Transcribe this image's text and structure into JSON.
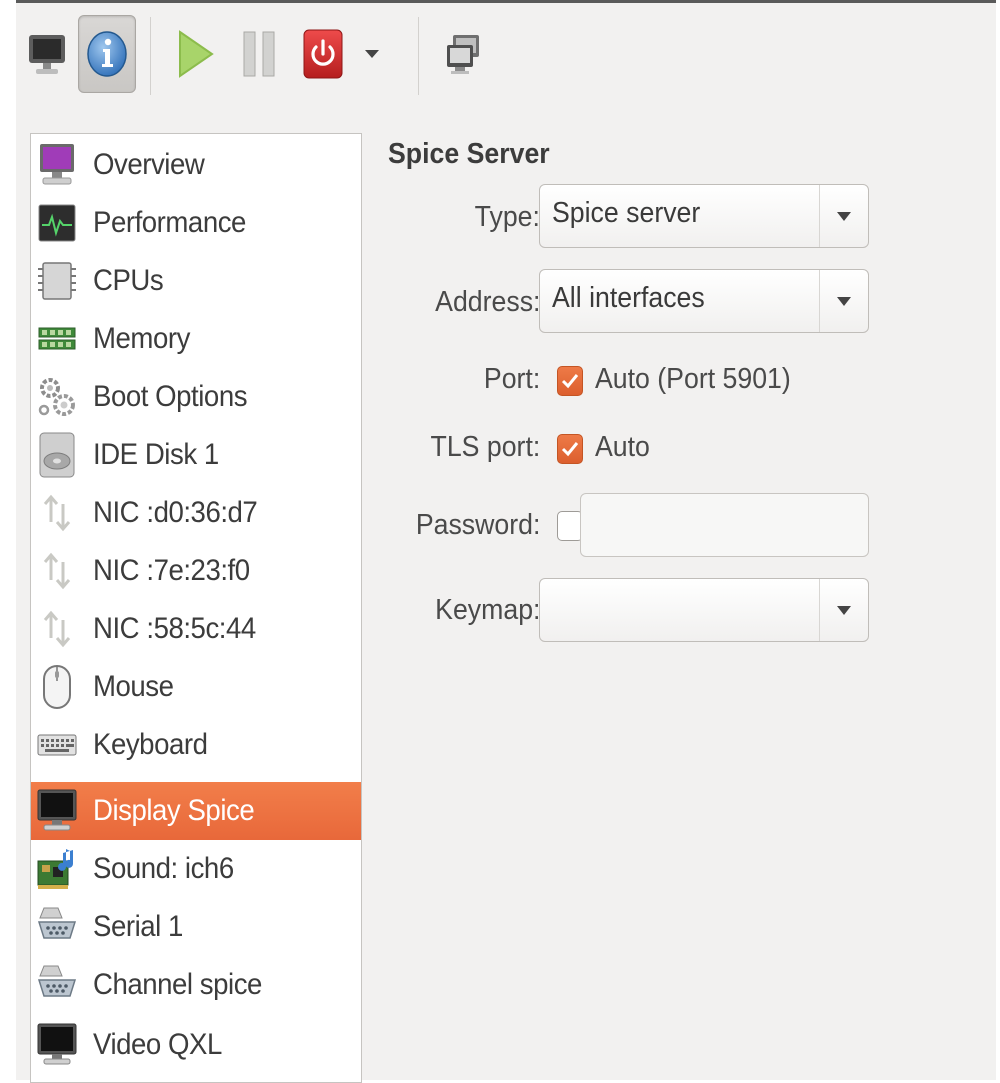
{
  "toolbar": {
    "buttons": [
      {
        "name": "console",
        "icon": "monitor-icon"
      },
      {
        "name": "details",
        "icon": "info-icon",
        "active": true
      },
      {
        "name": "run",
        "icon": "play-icon"
      },
      {
        "name": "pause",
        "icon": "pause-icon"
      },
      {
        "name": "shutdown",
        "icon": "power-icon"
      },
      {
        "name": "shutdown-menu",
        "icon": "chevron-down-icon"
      },
      {
        "name": "fullscreen",
        "icon": "fullscreen-icon"
      }
    ]
  },
  "sidebar": {
    "selected_index": 11,
    "items": [
      {
        "label": "Overview",
        "icon": "overview-monitor-icon"
      },
      {
        "label": "Performance",
        "icon": "performance-graph-icon"
      },
      {
        "label": "CPUs",
        "icon": "cpu-chip-icon"
      },
      {
        "label": "Memory",
        "icon": "memory-icon"
      },
      {
        "label": "Boot Options",
        "icon": "gears-icon"
      },
      {
        "label": "IDE Disk 1",
        "icon": "hard-disk-icon"
      },
      {
        "label": "NIC :d0:36:d7",
        "icon": "network-arrows-icon"
      },
      {
        "label": "NIC :7e:23:f0",
        "icon": "network-arrows-icon"
      },
      {
        "label": "NIC :58:5c:44",
        "icon": "network-arrows-icon"
      },
      {
        "label": "Mouse",
        "icon": "mouse-icon"
      },
      {
        "label": "Keyboard",
        "icon": "keyboard-icon"
      },
      {
        "label": "Display Spice",
        "icon": "display-icon"
      },
      {
        "label": "Sound: ich6",
        "icon": "sound-card-icon"
      },
      {
        "label": "Serial 1",
        "icon": "serial-port-icon"
      },
      {
        "label": "Channel spice",
        "icon": "serial-port-icon"
      },
      {
        "label": "Video QXL",
        "icon": "video-monitor-icon"
      }
    ]
  },
  "panel": {
    "title": "Spice Server",
    "type": {
      "label": "Type:",
      "value": "Spice server"
    },
    "address": {
      "label": "Address:",
      "value": "All interfaces"
    },
    "port": {
      "label": "Port:",
      "checked": true,
      "check_label": "Auto (Port 5901)"
    },
    "tls_port": {
      "label": "TLS port:",
      "checked": true,
      "check_label": "Auto"
    },
    "password": {
      "label": "Password:",
      "checked": false,
      "value": ""
    },
    "keymap": {
      "label": "Keymap:",
      "value": ""
    }
  },
  "colors": {
    "accent": "#f07746",
    "selection": "#ec6f3f",
    "window_bg": "#f2f1f0",
    "power_red": "#d62b2b",
    "play_green": "#8cc43c"
  }
}
